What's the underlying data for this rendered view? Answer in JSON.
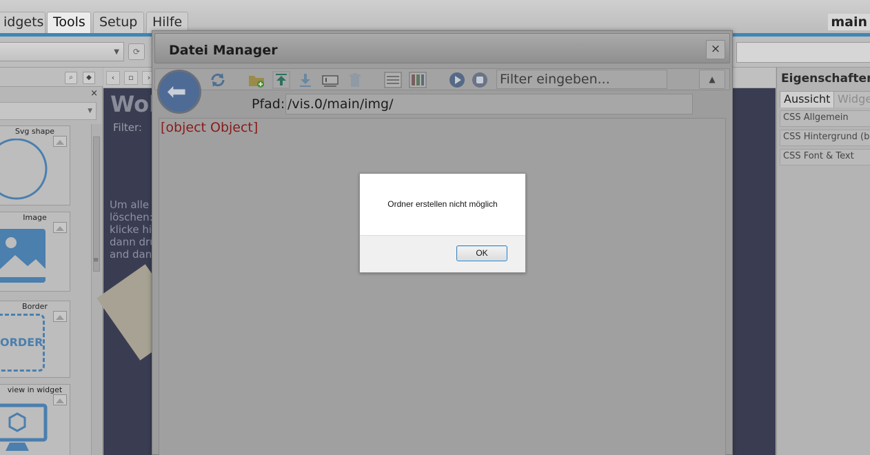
{
  "menu": {
    "tabs": [
      "idgets",
      "Tools",
      "Setup",
      "Hilfe"
    ],
    "active_tab": "Tools",
    "project_name": "main"
  },
  "widget_palette": {
    "items": [
      {
        "label": "Svg shape",
        "icon": "circle-shape-icon"
      },
      {
        "label": "Image",
        "icon": "image-icon"
      },
      {
        "label": "Border",
        "icon": "border-icon",
        "preview_text": "ORDER"
      },
      {
        "label": "view in widget",
        "icon": "monitor-cube-icon"
      }
    ]
  },
  "canvas": {
    "title": "Woh",
    "filter_label": "Filter:",
    "text_lines": [
      "Um alle W",
      "löschen:",
      "klicke hie",
      "dann drü",
      "and dann"
    ]
  },
  "properties": {
    "title": "Eigenschaften",
    "tabs": [
      "Aussicht",
      "Widge"
    ],
    "rows": [
      "CSS Allgemein",
      "CSS Hintergrund (ba",
      "CSS Font & Text"
    ]
  },
  "file_manager": {
    "title": "Datei Manager",
    "close_symbol": "×",
    "filter_placeholder": "Filter eingeben...",
    "path_label": "Pfad:",
    "path_value": "/vis.0/main/img/",
    "error_text": "[object Object]",
    "toolbar_icons": [
      "refresh-icon",
      "new-folder-icon",
      "upload-icon",
      "download-icon",
      "rename-icon",
      "delete-icon",
      "list-view-icon",
      "grid-view-icon",
      "play-icon",
      "stop-icon"
    ]
  },
  "alert": {
    "message": "Ordner erstellen nicht möglich",
    "ok_label": "OK"
  },
  "colors": {
    "accent_blue": "#3d87b8",
    "error_red": "#8a1a1a",
    "ok_border": "#3c7fb1"
  }
}
